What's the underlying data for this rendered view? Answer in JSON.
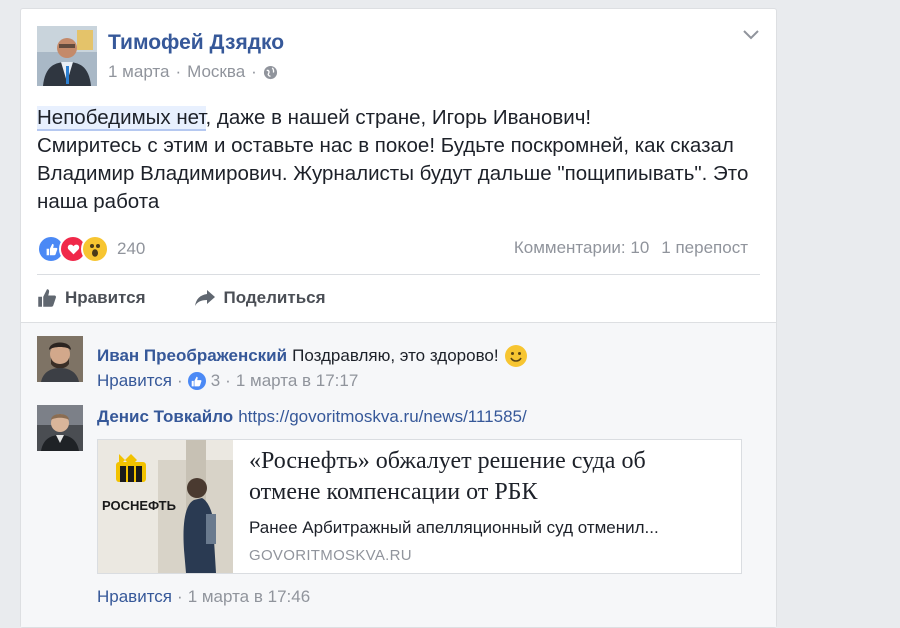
{
  "post": {
    "author": "Тимофей Дзядко",
    "date": "1 марта",
    "location": "Москва",
    "separator": "·",
    "text_highlight": "Непобедимых нет",
    "text_rest": ", даже в нашей стране, Игорь Иванович!",
    "text_line2": "Смиритесь с этим и оставьте нас в покое! Будьте поскромней, как сказал Владимир Владимирович. Журналисты будут дальше \"пощипиывать\". Это наша работа",
    "reaction_count": "240",
    "comments_count": "Комментарии: 10",
    "shares_count": "1 перепост",
    "like_label": "Нравится",
    "share_label": "Поделиться"
  },
  "comments": [
    {
      "author": "Иван Преображенский",
      "text": "Поздравляю, это здорово!",
      "like_label": "Нравится",
      "likes": "3",
      "timestamp": "1 марта в 17:17",
      "separator": "·"
    },
    {
      "author": "Денис Товкайло",
      "link_text": "https://govoritmoskva.ru/news/111585/",
      "like_label": "Нравится",
      "timestamp": "1 марта в 17:46",
      "separator": "·",
      "preview": {
        "title": "«Роснефть» обжалует решение суда об отмене компенсации от РБК",
        "description": "Ранее Арбитражный апелляционный суд отменил...",
        "domain": "GOVORITMOSKVA.RU",
        "image_logo_text": "РОСНЕФТЬ"
      }
    }
  ],
  "colors": {
    "name": "#365899",
    "meta": "#90949c",
    "like_blue": "#4b89f5",
    "love_red": "#f0284a",
    "wow_yellow": "#f7c531"
  },
  "icons": [
    "chevron-down-icon",
    "globe-icon",
    "like-reaction-icon",
    "love-reaction-icon",
    "wow-reaction-icon",
    "thumbs-up-icon",
    "share-arrow-icon",
    "smile-emoji-icon"
  ]
}
